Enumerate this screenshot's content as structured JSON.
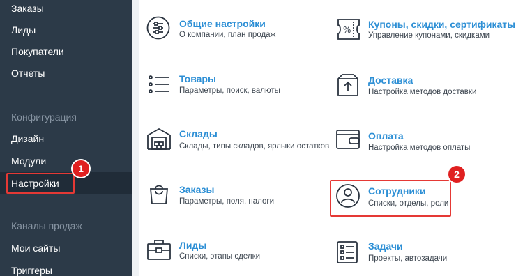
{
  "sidebar": {
    "items_top": [
      {
        "label": "Заказы"
      },
      {
        "label": "Лиды"
      },
      {
        "label": "Покупатели"
      },
      {
        "label": "Отчеты"
      }
    ],
    "section_config": "Конфигурация",
    "items_config": [
      {
        "label": "Дизайн"
      },
      {
        "label": "Модули"
      },
      {
        "label": "Настройки"
      }
    ],
    "section_channels": "Каналы продаж",
    "items_channels": [
      {
        "label": "Мои сайты"
      },
      {
        "label": "Триггеры"
      }
    ]
  },
  "settings": {
    "left": [
      {
        "title": "Общие настройки",
        "subtitle": "О компании, план продаж",
        "icon": "sliders-icon"
      },
      {
        "title": "Товары",
        "subtitle": "Параметры, поиск, валюты",
        "icon": "list-icon"
      },
      {
        "title": "Склады",
        "subtitle": "Склады, типы складов, ярлыки остатков",
        "icon": "warehouse-icon"
      },
      {
        "title": "Заказы",
        "subtitle": "Параметры, поля, налоги",
        "icon": "bag-icon"
      },
      {
        "title": "Лиды",
        "subtitle": "Списки, этапы сделки",
        "icon": "briefcase-icon"
      }
    ],
    "right": [
      {
        "title": "Купоны, скидки, сертификаты",
        "subtitle": "Управление купонами, скидками",
        "icon": "coupon-icon"
      },
      {
        "title": "Доставка",
        "subtitle": "Настройка методов доставки",
        "icon": "delivery-box-icon"
      },
      {
        "title": "Оплата",
        "subtitle": "Настройка методов оплаты",
        "icon": "wallet-icon"
      },
      {
        "title": "Сотрудники",
        "subtitle": "Списки, отделы, роли",
        "icon": "user-icon"
      },
      {
        "title": "Задачи",
        "subtitle": "Проекты, автозадачи",
        "icon": "checklist-icon"
      }
    ]
  },
  "annotations": {
    "badge_1": "1",
    "badge_2": "2",
    "highlight_color": "#e53935"
  }
}
